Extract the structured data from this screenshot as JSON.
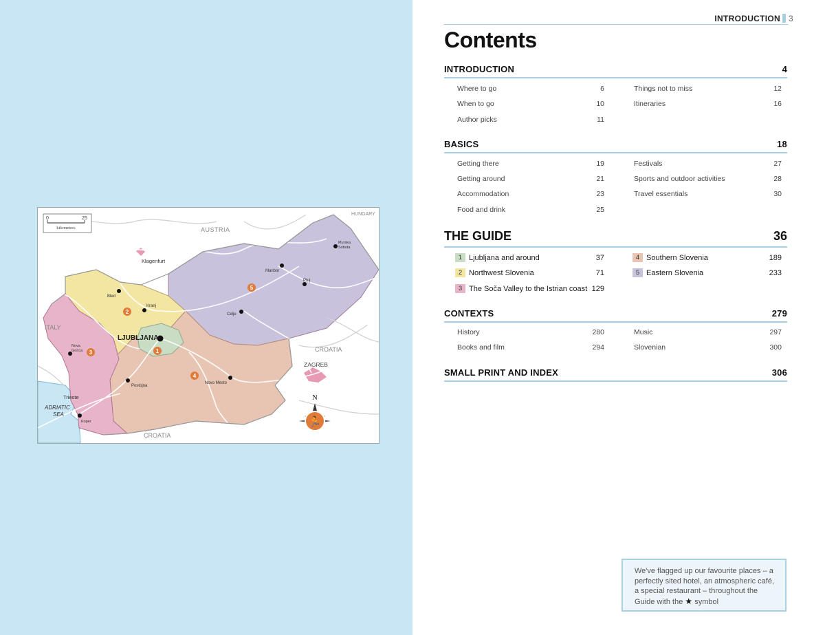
{
  "header": {
    "section_label": "INTRODUCTION",
    "page_number": "3"
  },
  "title": "Contents",
  "sections": {
    "introduction": {
      "title": "INTRODUCTION",
      "page": "4",
      "left": [
        {
          "label": "Where to go",
          "page": "6"
        },
        {
          "label": "When to go",
          "page": "10"
        },
        {
          "label": "Author picks",
          "page": "11"
        }
      ],
      "right": [
        {
          "label": "Things not to miss",
          "page": "12"
        },
        {
          "label": "Itineraries",
          "page": "16"
        }
      ]
    },
    "basics": {
      "title": "BASICS",
      "page": "18",
      "left": [
        {
          "label": "Getting there",
          "page": "19"
        },
        {
          "label": "Getting around",
          "page": "21"
        },
        {
          "label": "Accommodation",
          "page": "23"
        },
        {
          "label": "Food and drink",
          "page": "25"
        }
      ],
      "right": [
        {
          "label": "Festivals",
          "page": "27"
        },
        {
          "label": "Sports and outdoor activities",
          "page": "28"
        },
        {
          "label": "Travel essentials",
          "page": "30"
        }
      ]
    },
    "guide": {
      "title": "THE GUIDE",
      "page": "36",
      "left": [
        {
          "num": "1",
          "label": "Ljubljana and around",
          "page": "37",
          "color": "#c9dcc4"
        },
        {
          "num": "2",
          "label": "Northwest Slovenia",
          "page": "71",
          "color": "#f2e6a2"
        },
        {
          "num": "3",
          "label": "The Soča Valley to the Istrian coast",
          "page": "129",
          "color": "#e8b4c9"
        }
      ],
      "right": [
        {
          "num": "4",
          "label": "Southern Slovenia",
          "page": "189",
          "color": "#e8c5b3"
        },
        {
          "num": "5",
          "label": "Eastern Slovenia",
          "page": "233",
          "color": "#c9c2dc"
        }
      ]
    },
    "contexts": {
      "title": "CONTEXTS",
      "page": "279",
      "left": [
        {
          "label": "History",
          "page": "280"
        },
        {
          "label": "Books and film",
          "page": "294"
        }
      ],
      "right": [
        {
          "label": "Music",
          "page": "297"
        },
        {
          "label": "Slovenian",
          "page": "300"
        }
      ]
    },
    "small_print": {
      "title": "SMALL PRINT AND INDEX",
      "page": "306"
    }
  },
  "note": {
    "text_before_icon": "We've flagged up our favourite places – a perfectly sited hotel, an atmospheric café, a special restaurant – throughout the Guide with the",
    "text_after_icon": "symbol",
    "icon": "star-icon"
  },
  "map": {
    "scale": {
      "zero": "0",
      "max": "25",
      "unit": "kilometres"
    },
    "countries": {
      "austria": "AUSTRIA",
      "hungary": "HUNGARY",
      "italy": "ITALY",
      "croatia_east": "CROATIA",
      "croatia_south": "CROATIA"
    },
    "sea": {
      "line1": "ADRIATIC",
      "line2": "SEA"
    },
    "capital": "LJUBLJANA",
    "cities": {
      "klagenfurt": "Klagenfurt",
      "maribor": "Maribor",
      "ptuj": "Ptuj",
      "murska_1": "Murska",
      "murska_2": "Sobota",
      "bled": "Bled",
      "kranj": "Kranj",
      "celje": "Celje",
      "nova_gorica_1": "Nova",
      "nova_gorica_2": "Gorica",
      "postojna": "Postojna",
      "novo_mesto": "Novo Mesto",
      "trieste": "Trieste",
      "koper": "Koper",
      "zagreb": "ZAGREB"
    },
    "compass_label": "N",
    "region_labels": [
      "1",
      "2",
      "3",
      "4",
      "5"
    ],
    "region_colors": {
      "ljubljana": "#c9dcc4",
      "northwest": "#f2e6a2",
      "soca": "#e8b4c9",
      "southern": "#e8c5b3",
      "eastern": "#c9c2dc",
      "sea": "#c9e6f4",
      "marker": "#e07b39"
    }
  }
}
